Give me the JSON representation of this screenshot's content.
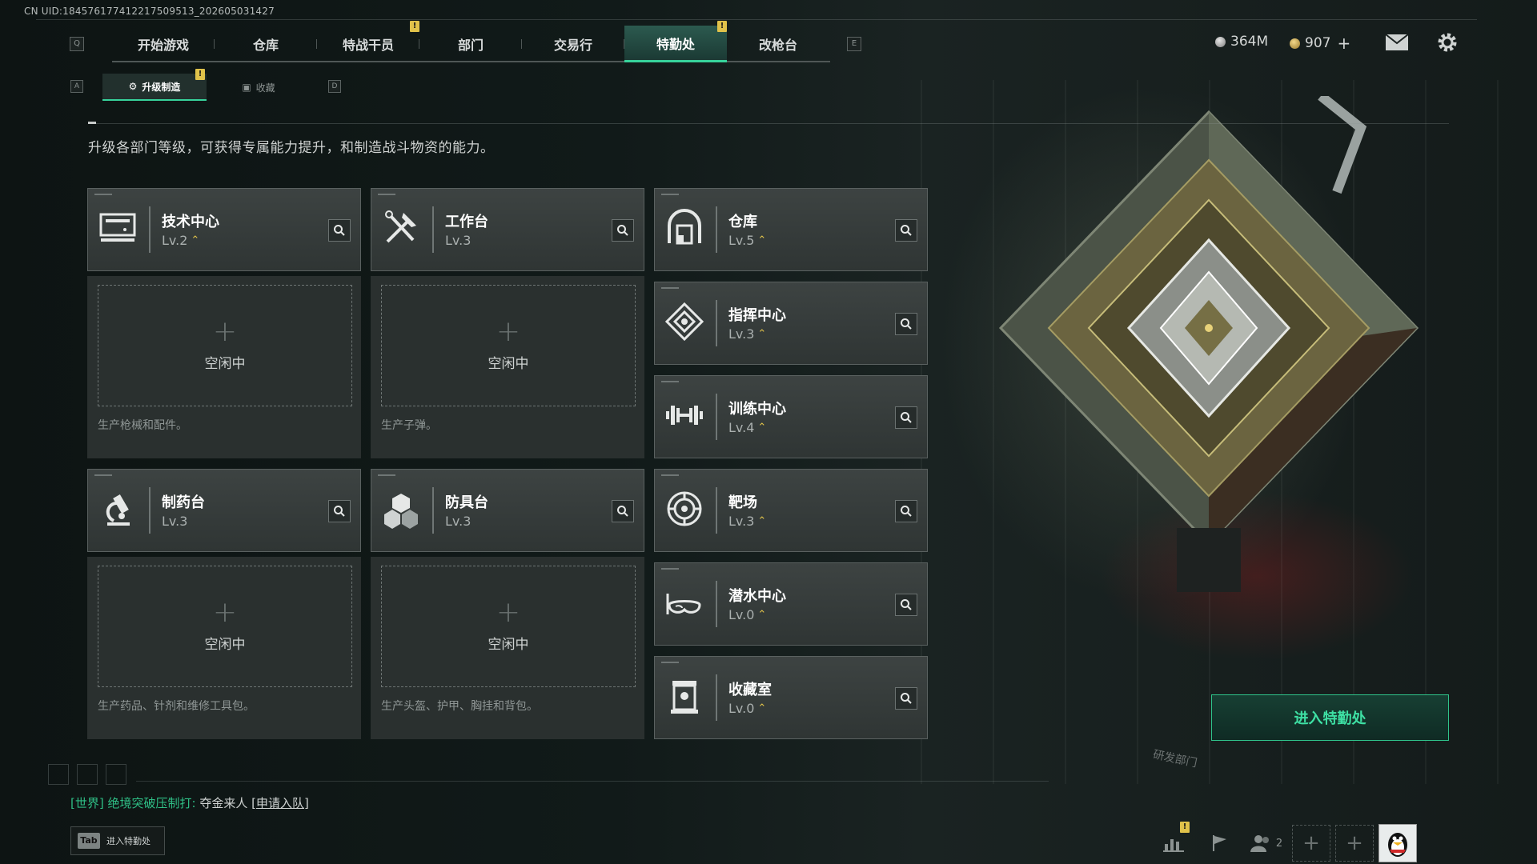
{
  "uid_text": "CN UID:1845761774122175095​13_202605031427",
  "nav": {
    "left_key": "Q",
    "right_key": "E",
    "tabs": [
      {
        "label": "开始游戏",
        "badge": ""
      },
      {
        "label": "仓库",
        "badge": ""
      },
      {
        "label": "特战干员",
        "badge": "!"
      },
      {
        "label": "部门",
        "badge": ""
      },
      {
        "label": "交易行",
        "badge": ""
      },
      {
        "label": "特勤处",
        "badge": "!",
        "active": true
      },
      {
        "label": "改枪台",
        "badge": ""
      }
    ]
  },
  "currency": {
    "silver": "364M",
    "gold": "907",
    "gold_plus": "+"
  },
  "subnav": {
    "left_key": "A",
    "right_key": "D",
    "tabs": [
      {
        "label": "升级制造",
        "badge": "!",
        "active": true
      },
      {
        "label": "收藏",
        "badge": ""
      }
    ]
  },
  "description": "升级各部门等级，可获得专属能力提升，和制造战斗物资的能力。",
  "departments_left": [
    {
      "name": "技术中心",
      "level": "Lv.2",
      "upgradable": true,
      "icon": "computer-icon",
      "idle": "空闲中",
      "produces": "生产枪械和配件。"
    },
    {
      "name": "工作台",
      "level": "Lv.3",
      "upgradable": false,
      "icon": "tools-icon",
      "idle": "空闲中",
      "produces": "生产子弹。"
    },
    {
      "name": "制药台",
      "level": "Lv.3",
      "upgradable": false,
      "icon": "microscope-icon",
      "idle": "空闲中",
      "produces": "生产药品、针剂和维修工具包。"
    },
    {
      "name": "防具台",
      "level": "Lv.3",
      "upgradable": false,
      "icon": "cubes-icon",
      "idle": "空闲中",
      "produces": "生产头盔、护甲、胸挂和背包。"
    }
  ],
  "departments_right": [
    {
      "name": "仓库",
      "level": "Lv.5",
      "upgradable": true,
      "icon": "warehouse-icon"
    },
    {
      "name": "指挥中心",
      "level": "Lv.3",
      "upgradable": true,
      "icon": "command-icon"
    },
    {
      "name": "训练中心",
      "level": "Lv.4",
      "upgradable": true,
      "icon": "dumbbell-icon"
    },
    {
      "name": "靶场",
      "level": "Lv.3",
      "upgradable": true,
      "icon": "target-icon"
    },
    {
      "name": "潜水中心",
      "level": "Lv.0",
      "upgradable": true,
      "icon": "diving-goggles-icon"
    },
    {
      "name": "收藏室",
      "level": "Lv.0",
      "upgradable": true,
      "icon": "display-case-icon"
    }
  ],
  "enter_button": "进入特勤处",
  "scene_label": "研发部门",
  "chat": {
    "channel": "[世界]",
    "sender": "绝境突破压制打:",
    "message": "夺金来人",
    "link": "[申请入队]"
  },
  "tab_hint": {
    "key": "Tab",
    "label": "进入特勤处"
  },
  "bottom_bar": {
    "friends_count": "2",
    "badge": "!"
  },
  "colors": {
    "accent": "#37d39b",
    "badge": "#e0c24a",
    "upgrade_arrow": "#e0c24a"
  }
}
